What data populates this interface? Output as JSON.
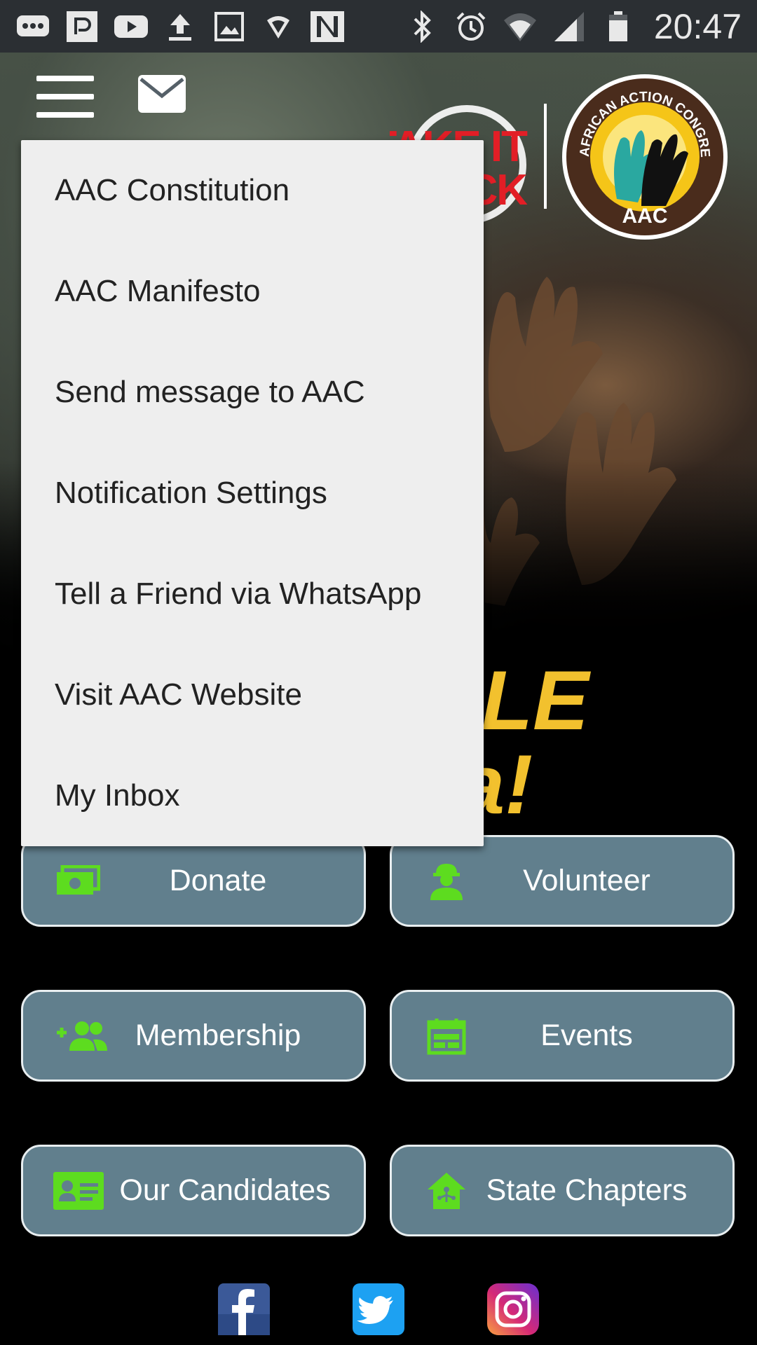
{
  "status_bar": {
    "time": "20:47",
    "left_icons": [
      "chat-icon",
      "p-app-icon",
      "youtube-icon",
      "upload-icon",
      "image-icon",
      "shield-wifi-icon",
      "n-app-icon"
    ],
    "right_icons": [
      "bluetooth-icon",
      "alarm-icon",
      "wifi-icon",
      "signal-icon",
      "battery-icon"
    ]
  },
  "header": {
    "menu_icon": "hamburger-icon",
    "mail_icon": "mail-icon"
  },
  "logo": {
    "campaign_text": "TAKE IT BACK",
    "ring_text": "AFRICAN ACTION CONGRESS",
    "abbr": "AAC"
  },
  "hero": {
    "slogan": "LE\nia!"
  },
  "menu": {
    "items": [
      {
        "label": "AAC Constitution"
      },
      {
        "label": "AAC Manifesto"
      },
      {
        "label": "Send message to AAC"
      },
      {
        "label": "Notification Settings"
      },
      {
        "label": "Tell a Friend via WhatsApp"
      },
      {
        "label": "Visit AAC Website"
      },
      {
        "label": "My Inbox"
      }
    ]
  },
  "actions": [
    {
      "label": "Donate",
      "icon": "money-icon"
    },
    {
      "label": "Volunteer",
      "icon": "worker-icon"
    },
    {
      "label": "Membership",
      "icon": "add-group-icon"
    },
    {
      "label": "Events",
      "icon": "calendar-icon"
    },
    {
      "label": "Our Candidates",
      "icon": "id-card-icon"
    },
    {
      "label": "State Chapters",
      "icon": "home-network-icon"
    }
  ],
  "social": [
    "facebook-icon",
    "twitter-icon",
    "instagram-icon"
  ],
  "colors": {
    "button_bg": "#617f8d",
    "icon_green": "#5ddc1f",
    "menu_bg": "#eeeeee",
    "slogan_yellow": "#f2c12e",
    "take_back_red": "#e21e26"
  }
}
